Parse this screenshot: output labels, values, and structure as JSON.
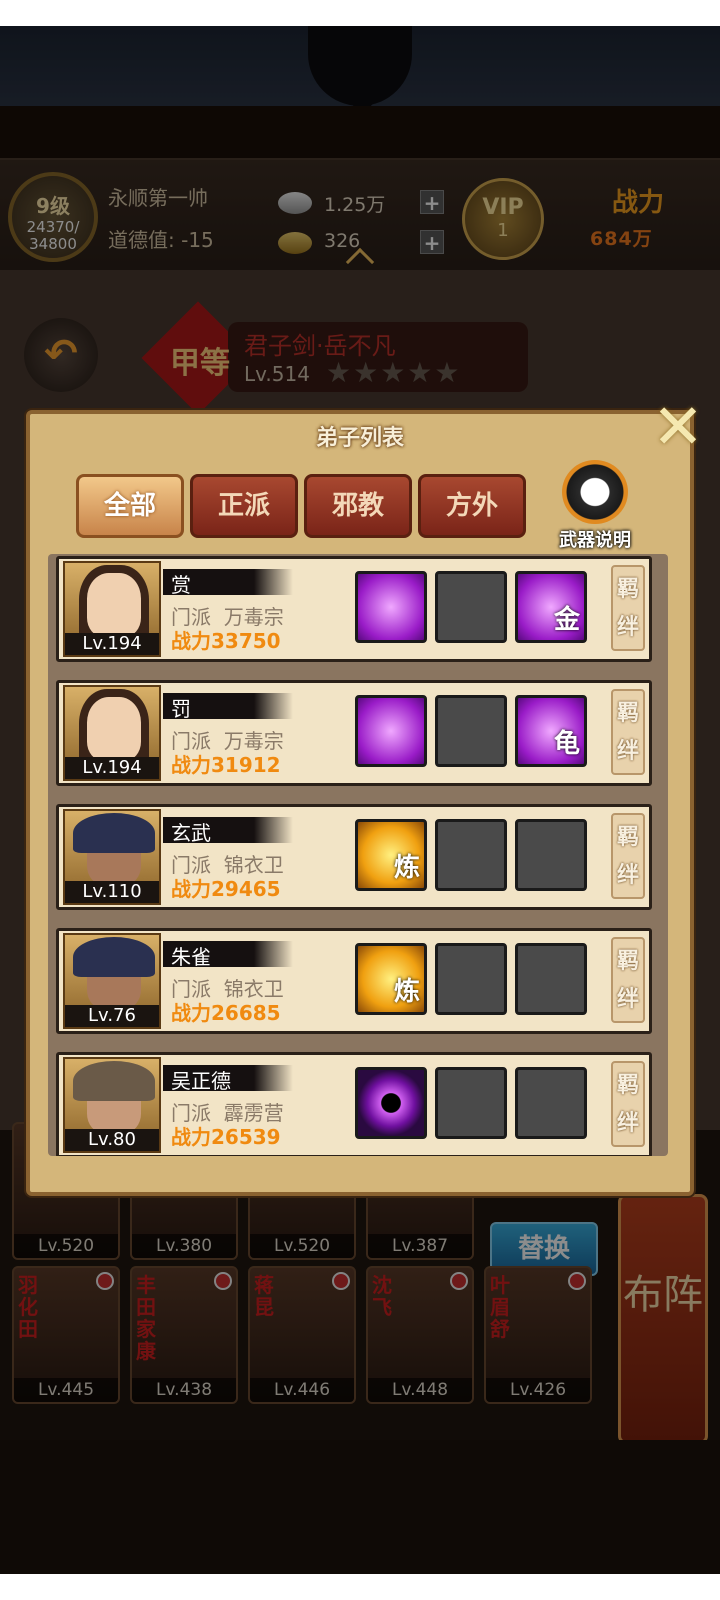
{
  "status": {
    "level": "9级",
    "exp": "24370/",
    "exp_max": "34800",
    "player_name": "永顺第一帅",
    "moral_label": "道德值:",
    "moral_value": "-15",
    "silver": "1.25万",
    "gold": "326",
    "vip_label": "VIP",
    "vip_level": "1",
    "power_title": "战力",
    "power_value": "684万"
  },
  "hero": {
    "rank": "甲等",
    "name": "君子剑·岳不凡",
    "level": "Lv.514",
    "stars": "★★★★★"
  },
  "modal": {
    "title": "弟子列表",
    "tabs": [
      "全部",
      "正派",
      "邪教",
      "方外"
    ],
    "active_tab": "全部",
    "weapon_help": "武器说明",
    "sect_label": "门派",
    "power_label": "战力",
    "bond_label": "羁绊",
    "disciples": [
      {
        "name": "赏",
        "level": "Lv.194",
        "sect": "万毒宗",
        "power": "33750",
        "slot3_glyph": "金"
      },
      {
        "name": "罚",
        "level": "Lv.194",
        "sect": "万毒宗",
        "power": "31912",
        "slot3_glyph": "龟"
      },
      {
        "name": "玄武",
        "level": "Lv.110",
        "sect": "锦衣卫",
        "power": "29465",
        "slot1_glyph": "炼"
      },
      {
        "name": "朱雀",
        "level": "Lv.76",
        "sect": "锦衣卫",
        "power": "26685",
        "slot1_glyph": "炼"
      },
      {
        "name": "吴正德",
        "level": "Lv.80",
        "sect": "霹雳营",
        "power": "26539"
      }
    ]
  },
  "roster": {
    "row1": [
      "Lv.520",
      "Lv.380",
      "Lv.520",
      "Lv.387"
    ],
    "row2": [
      {
        "name": "羽化田",
        "level": "Lv.445"
      },
      {
        "name": "丰田家康",
        "level": "Lv.438"
      },
      {
        "name": "蒋昆",
        "level": "Lv.446"
      },
      {
        "name": "沈飞",
        "level": "Lv.448"
      },
      {
        "name": "叶眉舒",
        "level": "Lv.426"
      }
    ],
    "swap_label": "替换",
    "formation_label": "布阵"
  },
  "colors": {
    "accent_orange": "#f08a10",
    "modal_bg": "#d4b67a",
    "tab_active": "#c8844a",
    "tab_inactive": "#7a2418"
  }
}
